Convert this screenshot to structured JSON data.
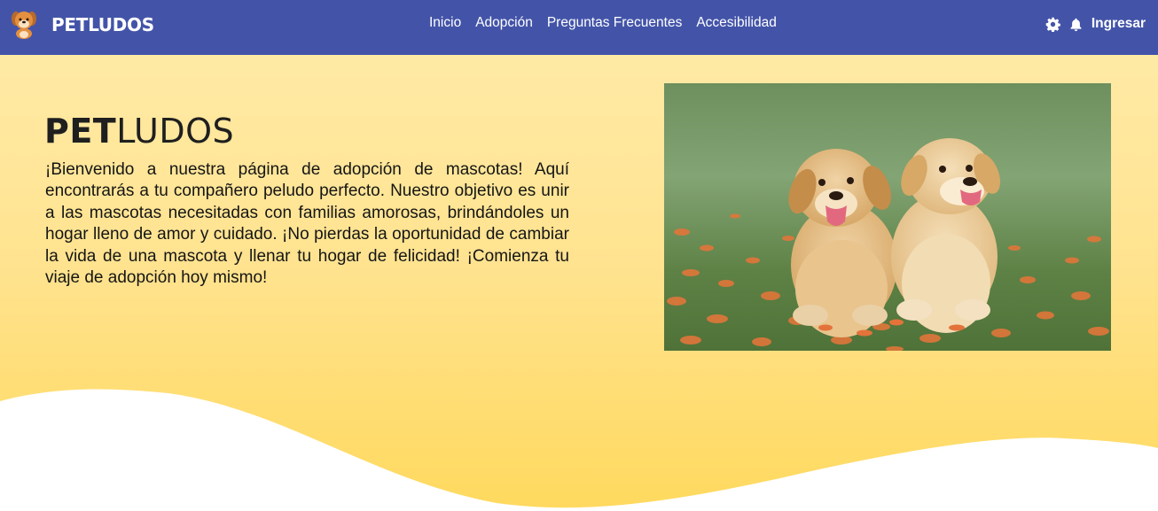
{
  "navbar": {
    "brand": "PETLUDOS",
    "links": [
      "Inicio",
      "Adopción",
      "Preguntas Frecuentes",
      "Accesibilidad"
    ],
    "icons": [
      "gear-icon",
      "bell-icon"
    ],
    "login": "Ingresar",
    "colors": {
      "background": "#4354a8",
      "text": "#ffffff"
    }
  },
  "hero": {
    "title_bold": "PET",
    "title_light": "LUDOS",
    "text": "¡Bienvenido a nuestra página de adopción de mascotas! Aquí encontrarás a tu compañero peludo perfecto. Nuestro objetivo es unir a las mascotas necesitadas con familias amorosas, brindándoles un hogar lleno de amor y cuidado. ¡No pierdas la oportunidad de cambiar la vida de una mascota y llenar tu hogar de felicidad! ¡Comienza tu viaje de adopción hoy mismo!",
    "colors": {
      "gradient_top": "#ffeaa5",
      "gradient_bottom": "#ffd95e"
    }
  }
}
